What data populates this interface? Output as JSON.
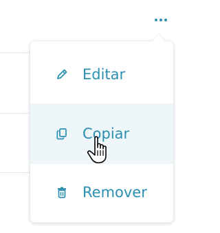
{
  "colors": {
    "accent": "#2b8fb0",
    "hover_row": "#eef6f9",
    "divider": "#e4e8ea"
  },
  "trigger": {
    "icon": "more-horizontal-icon"
  },
  "menu": {
    "items": [
      {
        "label": "Editar",
        "icon": "pencil-icon"
      },
      {
        "label": "Copiar",
        "icon": "copy-icon"
      },
      {
        "label": "Remover",
        "icon": "trash-icon"
      }
    ]
  },
  "cursor": {
    "icon": "hand-pointer-cursor"
  }
}
